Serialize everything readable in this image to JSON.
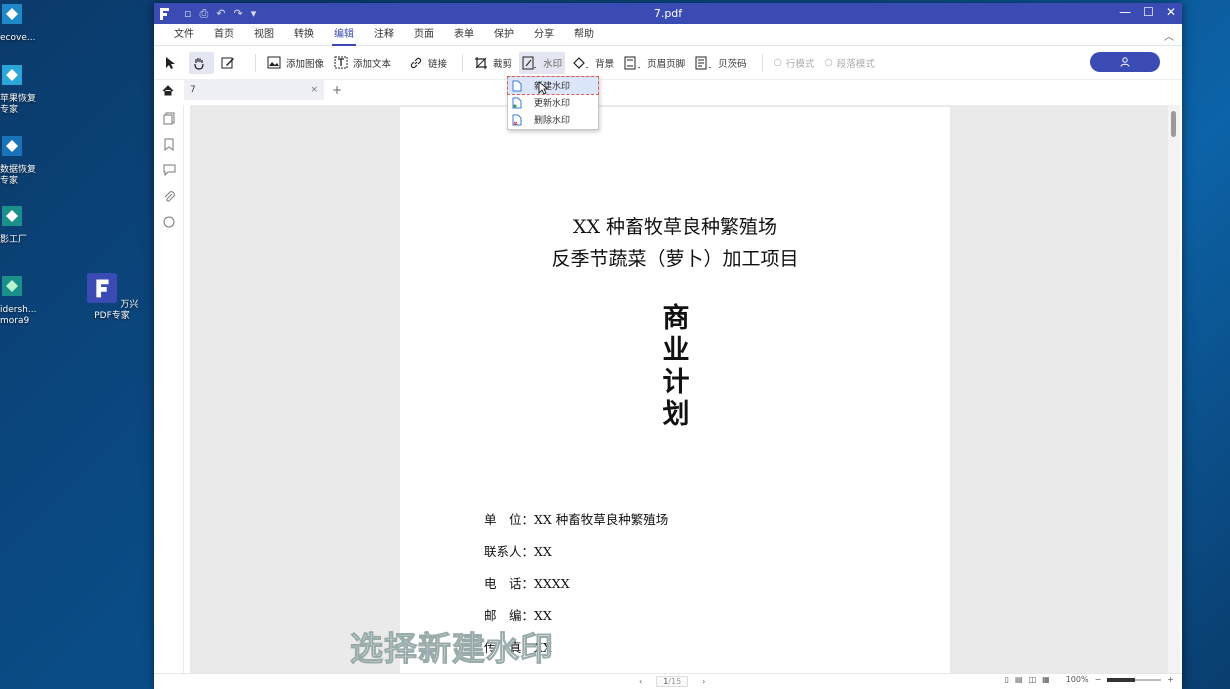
{
  "desktop": {
    "icons": [
      {
        "label1": "ecove...",
        "label2": ""
      },
      {
        "label1": "苹果恢复",
        "label2": "专家"
      },
      {
        "label1": "数据恢复",
        "label2": "专家"
      },
      {
        "label1": "影工厂",
        "label2": ""
      },
      {
        "label1": "idersh...",
        "label2": "mora9"
      },
      {
        "label1": "万兴PDF专家",
        "label2": ""
      }
    ]
  },
  "window": {
    "title": "7.pdf",
    "menu": [
      "文件",
      "首页",
      "视图",
      "转换",
      "编辑",
      "注释",
      "页面",
      "表单",
      "保护",
      "分享",
      "帮助"
    ],
    "active_menu": "编辑",
    "toolbar": {
      "add_image": "添加图像",
      "add_text": "添加文本",
      "link": "链接",
      "crop": "裁剪",
      "watermark": "水印",
      "background": "背景",
      "header_footer": "页眉页脚",
      "bates": "贝茨码",
      "line_mode": "行模式",
      "para_mode": "段落模式"
    },
    "tab": {
      "name": "7"
    },
    "watermark_menu": [
      "新建水印",
      "更新水印",
      "删除水印"
    ],
    "status": {
      "page": "1",
      "total": "/15",
      "zoom": "100%"
    }
  },
  "document": {
    "title1": "XX 种畜牧草良种繁殖场",
    "title2": "反季节蔬菜（萝卜）加工项目",
    "big": [
      "商",
      "业",
      "计",
      "划"
    ],
    "info": [
      "单　位：XX 种畜牧草良种繁殖场",
      "联系人：XX",
      "电　话：XXXX",
      "邮　编：XX",
      "传　真：XX"
    ]
  },
  "caption": "选择新建水印",
  "colors": {
    "brand": "#3a4cb4",
    "highlight": "#dbe6fa"
  }
}
